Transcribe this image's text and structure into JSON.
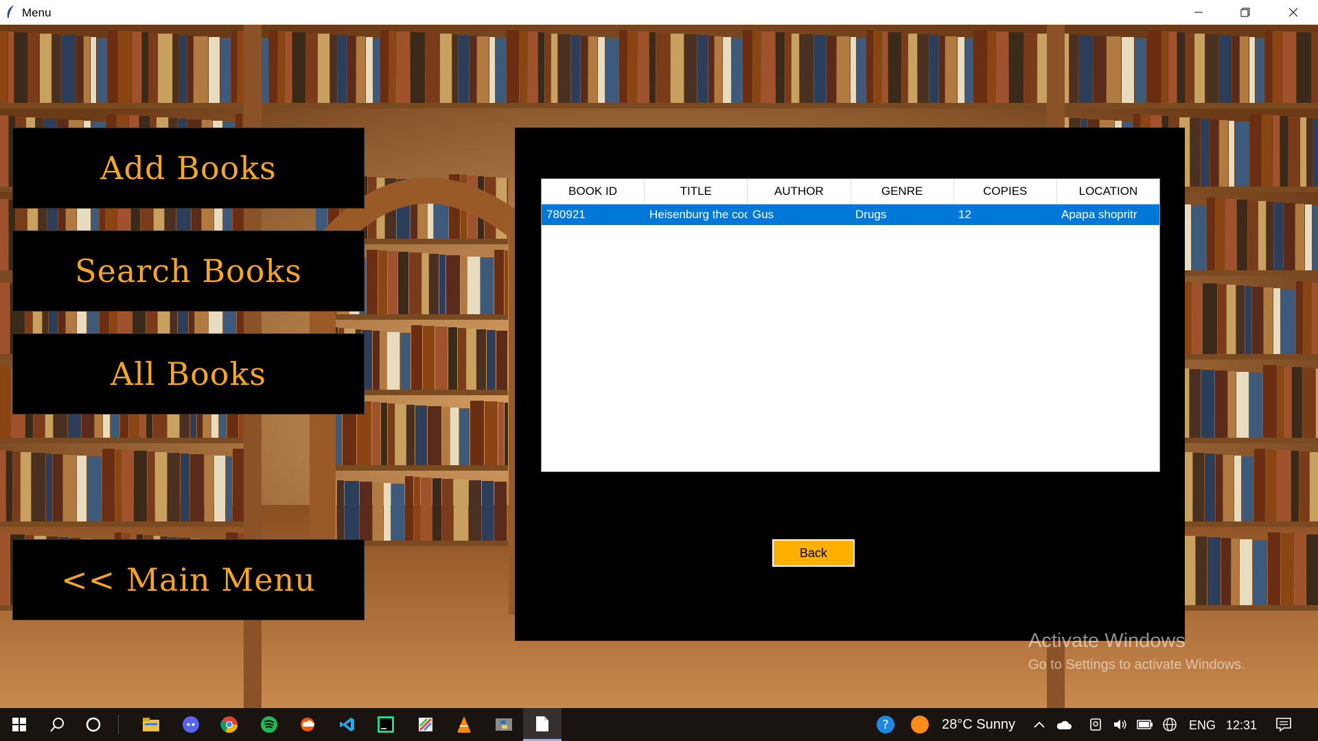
{
  "window": {
    "title": "Menu"
  },
  "menu": {
    "add_books": "Add Books",
    "search_books": "Search Books",
    "all_books": "All Books",
    "main_menu": "<< Main Menu"
  },
  "table": {
    "columns": [
      "BOOK ID",
      "TITLE",
      "AUTHOR",
      "GENRE",
      "COPIES",
      "LOCATION"
    ],
    "rows": [
      [
        "780921",
        "Heisenburg the cook",
        "Gus",
        "Drugs",
        "12",
        "Apapa shopritr"
      ]
    ]
  },
  "back_button": "Back",
  "watermark": {
    "line1": "Activate Windows",
    "line2": "Go to Settings to activate Windows."
  },
  "taskbar": {
    "weather": "28°C  Sunny",
    "language": "ENG",
    "time": "12:31",
    "apps": [
      "file-explorer-icon",
      "discord-icon",
      "chrome-icon",
      "spotify-icon",
      "soundcloud-icon",
      "vscode-icon",
      "pycharm-icon",
      "paint-icon",
      "vlc-icon",
      "python-icon",
      "notepad-icon"
    ]
  },
  "colors": {
    "accent_text": "#f5a623",
    "selection": "#0078d7",
    "back_button": "#ffb000"
  }
}
